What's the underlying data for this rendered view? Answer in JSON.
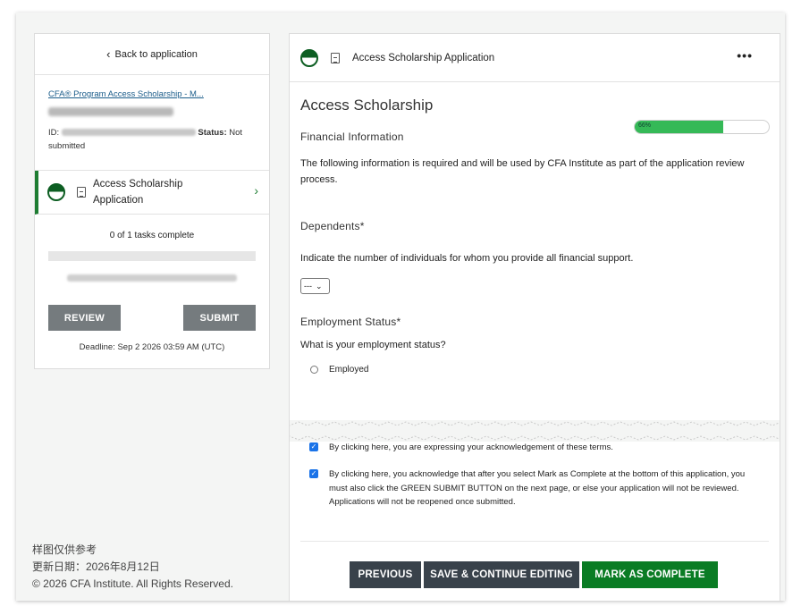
{
  "sidebar": {
    "back_label": "Back to application",
    "program_link": "CFA® Program Access Scholarship - M...",
    "id_prefix": "ID:",
    "status_label": "Status:",
    "status_value": "Not submitted",
    "task": {
      "label": "Access Scholarship Application"
    },
    "tasks_complete": "0 of 1 tasks complete",
    "tasks_progress": 0,
    "review_label": "REVIEW",
    "submit_label": "SUBMIT",
    "deadline": "Deadline: Sep 2 2026 03:59 AM (UTC)"
  },
  "footer": {
    "line1": "样图仅供参考",
    "line2": "更新日期：2026年8月12日",
    "line3": "© 2026 CFA Institute. All Rights Reserved."
  },
  "main": {
    "header_title": "Access Scholarship Application",
    "more_label": "•••",
    "title": "Access Scholarship",
    "progress_pct": 66,
    "progress_label": "66%",
    "section": "Financial Information",
    "intro": "The following information is required and will be used by CFA Institute as part of the application review process.",
    "dependents_label": "Dependents*",
    "dependents_help": "Indicate the number of individuals for whom you provide all financial support.",
    "dependents_value": "---",
    "employment_label": "Employment Status*",
    "employment_question": "What is your employment status?",
    "employment_option": "Employed",
    "ack1": "By clicking here, you are expressing your acknowledgement of these terms.",
    "ack2": "By clicking here, you acknowledge that after you select Mark as Complete at the bottom of this application, you must also click the GREEN SUBMIT BUTTON on the next page, or else your application will not be reviewed. Applications will not be reopened once submitted.",
    "buttons": {
      "previous": "PREVIOUS",
      "save": "SAVE & CONTINUE EDITING",
      "complete": "MARK AS COMPLETE"
    }
  },
  "colors": {
    "accent_green": "#0a7c24",
    "progress_green": "#35b957",
    "dark_button": "#39424b",
    "grey_button": "#757b7e",
    "link_blue": "#1a5c8a"
  }
}
